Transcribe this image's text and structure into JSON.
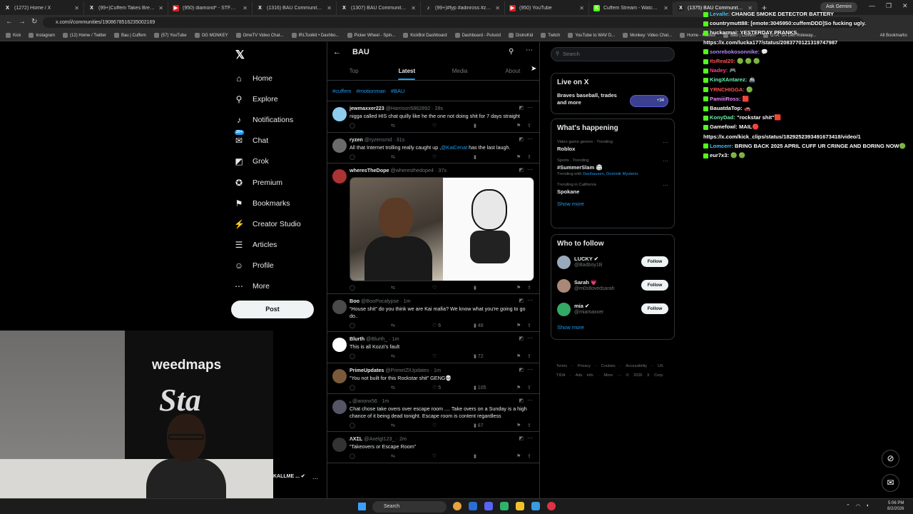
{
  "browser": {
    "tabs": [
      {
        "label": "(1272) Home / X",
        "color": "#222",
        "glyph": "X"
      },
      {
        "label": "(99+)Cuffem Takes Break After",
        "color": "#222",
        "glyph": "X"
      },
      {
        "label": "(950) diamond* - STFU (Official",
        "color": "#e02020",
        "glyph": "▶"
      },
      {
        "label": "(1316) BAU Community / X",
        "color": "#222",
        "glyph": "X"
      },
      {
        "label": "(1307) BAU Community / X",
        "color": "#222",
        "glyph": "X"
      },
      {
        "label": "(99+)#fyp #adinross #zherka #",
        "color": "#222",
        "glyph": "♪"
      },
      {
        "label": "(950) YouTube",
        "color": "#e02020",
        "glyph": "▶"
      },
      {
        "label": "Cuffem Stream - Watch Live on",
        "color": "#53fc18",
        "glyph": "K"
      },
      {
        "label": "(1375) BAU Community / X",
        "color": "#222",
        "glyph": "X"
      }
    ],
    "ask_gemini": "Ask Gemini",
    "url": "x.com/i/communities/1908678516235002169",
    "bookmarks": [
      "Kick",
      "Instagram",
      "(12) Home / Twitter",
      "Bau | Cuffem",
      "(57) YouTube",
      "OG MONKEY",
      "OmeTV Video Chat...",
      "IRLToolkit • Dashbo...",
      "Picker Wheel - Spin...",
      "KickBot Dashboard",
      "Dashboard - Pulsoid",
      "DistroKid",
      "Twitch",
      "YouTube to WAV D...",
      "Monkey: Video Chat...",
      "Home - Roblox",
      "Bau | Cuffem",
      "GTA: SA Dell Roleway..."
    ],
    "all_bookmarks": "All Bookmarks"
  },
  "nav": {
    "items": [
      {
        "label": "Home",
        "icon": "⌂"
      },
      {
        "label": "Explore",
        "icon": "⚲"
      },
      {
        "label": "Notifications",
        "icon": "♪"
      },
      {
        "label": "Chat",
        "icon": "✉"
      },
      {
        "label": "Grok",
        "icon": "◩"
      },
      {
        "label": "Premium",
        "icon": "✪"
      },
      {
        "label": "Bookmarks",
        "icon": "⚑"
      },
      {
        "label": "Creator Studio",
        "icon": "⚡"
      },
      {
        "label": "Articles",
        "icon": "☰"
      },
      {
        "label": "Profile",
        "icon": "☺"
      },
      {
        "label": "More",
        "icon": "⋯"
      }
    ],
    "chat_badge": "20+",
    "post_label": "Post"
  },
  "community": {
    "title": "BAU",
    "tabs": [
      "Top",
      "Latest",
      "Media",
      "About"
    ],
    "active_tab": "Latest",
    "hashtags": [
      "#cuffem",
      "#motionman",
      "#BAU"
    ]
  },
  "posts": [
    {
      "name": "jewmaxxer223",
      "handle": "@Harrison5862892",
      "time": "28s",
      "text": "nigga called HIS chat quilly like he the one not doing shit for 7 days straight",
      "avatar": "#8ecdf0",
      "likes": "",
      "views": ""
    },
    {
      "name": "ryzen",
      "handle": "@ryzensmd",
      "time": "31s",
      "text": "All that Internet trolling really caught up ,",
      "mention": "@KaiCenat",
      "text_after": " has the last laugh.",
      "avatar": "#6b6b6b",
      "likes": "",
      "views": ""
    },
    {
      "name": "wheresTheDope",
      "handle": "@wheresthedope4",
      "time": "37s",
      "text": "",
      "avatar": "#a33",
      "likes": "",
      "views": "",
      "has_images": true
    },
    {
      "name": "Boo",
      "handle": "@BooPocalypse",
      "time": "1m",
      "text": "“House shit” do you think we are Kai mafia? We know what you're going to go do..",
      "avatar": "#4a4a4a",
      "likes": "6",
      "views": "48"
    },
    {
      "name": "Blurth",
      "handle": "@Blurth_",
      "time": "1m",
      "text": "This is all Kozzi's fault",
      "avatar": "#ffffff",
      "likes": "",
      "views": "72"
    },
    {
      "name": "PrimeUpdates",
      "handle": "@PrimeIZIUpdates",
      "time": "1m",
      "text": "“You not built for this Rockstar shit” GENG💀",
      "avatar": "#7a5a3a",
      "likes": "5",
      "views": "105"
    },
    {
      "name": ".",
      "handle": "@anonx56",
      "time": "1m",
      "text": "Chat chose take overs over escape room .... Take overs on a Sunday is a high chance of it being dead tonight. Escape room is content regardless",
      "avatar": "#556",
      "likes": "",
      "views": "87"
    },
    {
      "name": "ΛXΣL",
      "handle": "@Axelgt123_",
      "time": "2m",
      "text": "“Takeovers or Escape Room”",
      "avatar": "#333",
      "likes": "",
      "views": ""
    }
  ],
  "right": {
    "search_placeholder": "Search",
    "live": {
      "heading": "Live on X",
      "title": "Braves baseball, trades and more",
      "count": "+34"
    },
    "happening": {
      "heading": "What's happening",
      "trends": [
        {
          "cat": "Video game genres · Trending",
          "name": "Roblox",
          "with": ""
        },
        {
          "cat": "Sports · Trending",
          "name": "#SummerSlam 🏟",
          "with_prefix": "Trending with ",
          "with": "Danhausen, Dominik Mysterio"
        },
        {
          "cat": "Trending in California",
          "name": "Spokane",
          "with": ""
        }
      ],
      "show_more": "Show more"
    },
    "who": {
      "heading": "Who to follow",
      "users": [
        {
          "name": "LUCKY ✔",
          "handle": "@Badboy1B",
          "color": "#9ab"
        },
        {
          "name": "Sarah 💗",
          "handle": "@m0stlovedsarah",
          "color": "#a87"
        },
        {
          "name": "mia ✔",
          "handle": "@miamaxxer",
          "color": "#3a6"
        }
      ],
      "follow_label": "Follow",
      "show_more": "Show more"
    },
    "footer": "Terms · Privacy · Cookies · Accessibility · US TIDA · Ads info · More ··· © 2026 X Corp."
  },
  "chat_overlay": [
    {
      "user": "Levalle:",
      "msg": "CHANGE SMOKE DETECTOR BATTERY",
      "color": "#4fc3f7"
    },
    {
      "user": "countrymutt88:",
      "msg": "[emote:3045950:cuffemDDD]So fucking ugly.",
      "color": "#ffffff"
    },
    {
      "user": "huckarmai:",
      "msg": "YESTERDAY PRANKS",
      "color": "#ffffff"
    },
    {
      "user": "",
      "msg": "https://x.com/lucka177/status/2083770121319747987",
      "color": "#ffffff"
    },
    {
      "user": "sonrebokosonnike:",
      "msg": "💬",
      "color": "#b388ff"
    },
    {
      "user": "ItsReal20:",
      "msg": "🟢 🟢 🟢",
      "color": "#ff5252"
    },
    {
      "user": "Nadey:",
      "msg": "🎮",
      "color": "#ff4081"
    },
    {
      "user": "KingXAntarez:",
      "msg": "🚢",
      "color": "#69f0ae"
    },
    {
      "user": "YRNCHIGGA:",
      "msg": "🟢",
      "color": "#ff5252"
    },
    {
      "user": "PamiiiRoss:",
      "msg": "🟥",
      "color": "#ea80fc"
    },
    {
      "user": "BauatdaTop:",
      "msg": "🚗",
      "color": "#ffffff"
    },
    {
      "user": "KonyDad:",
      "msg": "\"rockstar shit\"🟥",
      "color": "#69f0ae"
    },
    {
      "user": "Gamefowl:",
      "msg": "MAIL🔴",
      "color": "#ffffff"
    },
    {
      "user": "",
      "msg": "https://x.com/kick_clips/status/1829252393491673418/video/1",
      "color": "#ffffff"
    },
    {
      "user": "Lomcerr:",
      "msg": "BRING BACK 2025 APRIL CUFF UR CRINGE AND BORING NOW🟢",
      "color": "#40c4ff"
    },
    {
      "user": "eur7x3:",
      "msg": "🟢 🟢",
      "color": "#ffffff"
    }
  ],
  "webcam": {
    "banner_brand": "weedmaps",
    "banner_word": "Sta",
    "overlay_name": "KALLME ... ✔"
  },
  "taskbar": {
    "search": "Search",
    "time": "5:06 PM",
    "date": "8/2/2026"
  }
}
